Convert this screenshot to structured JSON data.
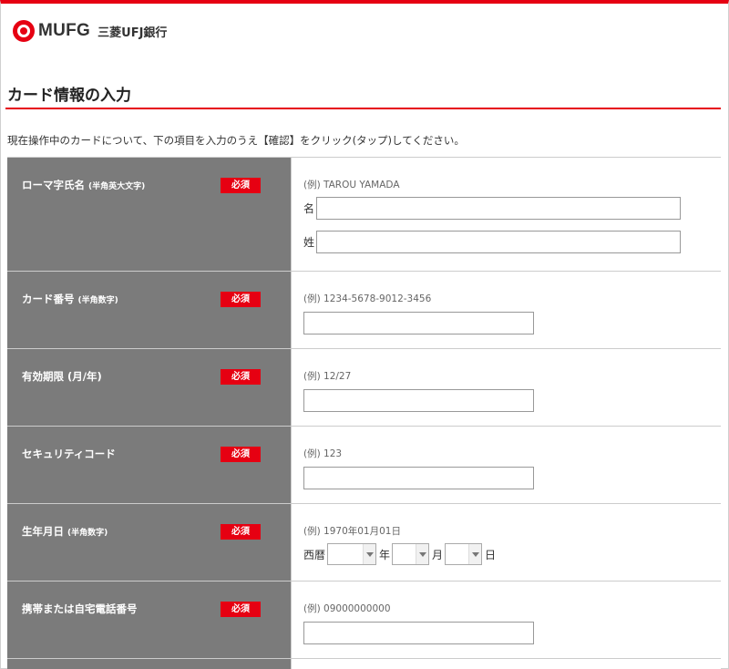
{
  "header": {
    "logo_text": "MUFG",
    "bank_name": "三菱UFJ銀行"
  },
  "page_title": "カード情報の入力",
  "intro": "現在操作中のカードについて、下の項目を入力のうえ【確認】をクリック(タップ)してください。",
  "required_label": "必須",
  "fields": {
    "name": {
      "label": "ローマ字氏名",
      "note": "(半角英大文字)",
      "example": "(例)  TAROU YAMADA",
      "first_label": "名",
      "last_label": "姓"
    },
    "card_number": {
      "label": "カード番号",
      "note": "(半角数字)",
      "example": "(例)  1234-5678-9012-3456"
    },
    "expiry": {
      "label": "有効期限 (月/年)",
      "example": "(例)  12/27"
    },
    "security_code": {
      "label": "セキュリティコード",
      "example": "(例)  123"
    },
    "birthdate": {
      "label": "生年月日",
      "note": "(半角数字)",
      "example": "(例)  1970年01月01日",
      "era_label": "西暦",
      "year_label": "年",
      "month_label": "月",
      "day_label": "日",
      "year_value": "",
      "month_value": "",
      "day_value": ""
    },
    "phone": {
      "label": "携帯または自宅電話番号",
      "example": "(例)  09000000000"
    }
  }
}
